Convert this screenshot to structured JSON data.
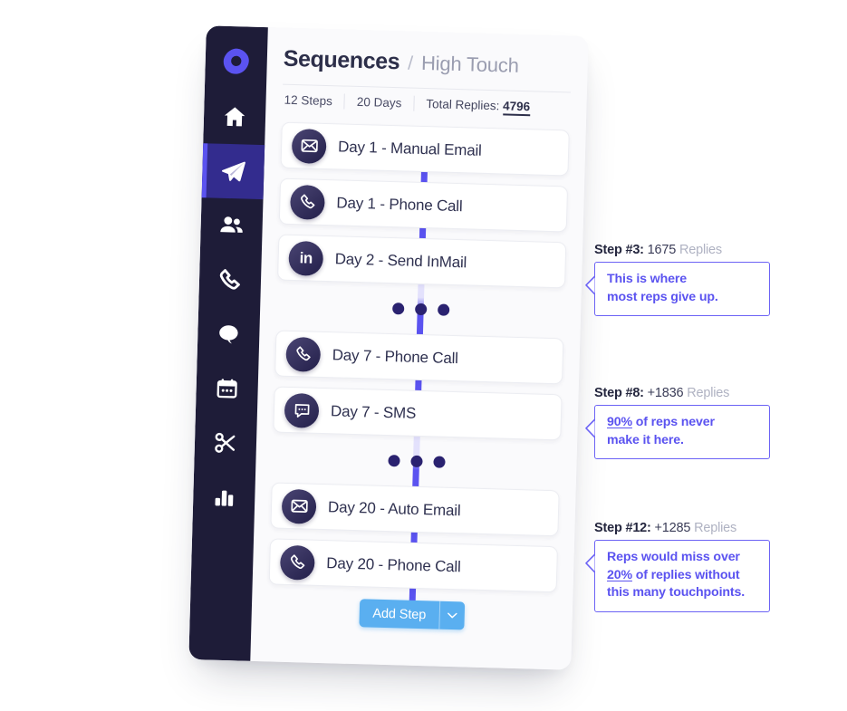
{
  "app": {
    "logo_icon": "droplet-logo-icon",
    "sidebar": {
      "items": [
        {
          "icon": "home-icon",
          "name": "home",
          "active": false
        },
        {
          "icon": "paper-plane-icon",
          "name": "sequences",
          "active": true
        },
        {
          "icon": "people-icon",
          "name": "contacts",
          "active": false
        },
        {
          "icon": "phone-icon",
          "name": "calls",
          "active": false
        },
        {
          "icon": "chat-bubble-icon",
          "name": "messages",
          "active": false
        },
        {
          "icon": "calendar-icon",
          "name": "calendar",
          "active": false
        },
        {
          "icon": "scissors-icon",
          "name": "snippets",
          "active": false
        },
        {
          "icon": "bar-chart-icon",
          "name": "analytics",
          "active": false
        }
      ]
    }
  },
  "header": {
    "title": "Sequences",
    "separator": "/",
    "subtitle": "High Touch",
    "meta": {
      "steps": "12 Steps",
      "days": "20 Days",
      "replies_label": "Total Replies:",
      "replies_value": "4796"
    }
  },
  "steps": [
    {
      "icon": "envelope-icon",
      "label": "Day 1 - Manual Email"
    },
    {
      "icon": "phone-icon",
      "label": "Day 1 - Phone Call"
    },
    {
      "icon": "linkedin-icon",
      "label": "Day 2 - Send InMail",
      "icon_text": "in"
    },
    {
      "icon": "ellipsis-icon",
      "label": "",
      "type": "ellipsis"
    },
    {
      "icon": "phone-icon",
      "label": "Day 7 - Phone Call"
    },
    {
      "icon": "sms-bubble-icon",
      "label": "Day 7 - SMS"
    },
    {
      "icon": "ellipsis-icon",
      "label": "",
      "type": "ellipsis"
    },
    {
      "icon": "envelope-icon",
      "label": "Day 20 - Auto Email"
    },
    {
      "icon": "phone-icon",
      "label": "Day 20 - Phone Call"
    }
  ],
  "add_step": {
    "label": "Add Step",
    "caret_icon": "chevron-down-icon"
  },
  "annotations": [
    {
      "step": "Step #3:",
      "count": "1675",
      "replies": "Replies",
      "lines": [
        {
          "text": "This is where"
        },
        {
          "text": "most reps give up."
        }
      ]
    },
    {
      "step": "Step #8:",
      "count": "+1836",
      "replies": "Replies",
      "lines": [
        {
          "underline": "90%",
          "text": " of reps never"
        },
        {
          "text": "make it here."
        }
      ]
    },
    {
      "step": "Step #12:",
      "count": "+1285",
      "replies": "Replies",
      "lines": [
        {
          "text": "Reps would miss over"
        },
        {
          "underline": "20%",
          "text": " of replies without"
        },
        {
          "text": "this many touchpoints."
        }
      ]
    }
  ],
  "colors": {
    "sidebar_bg": "#1E1C38",
    "sidebar_active_bg": "#332C8E",
    "accent_purple": "#5B53F0",
    "connector_purple": "#5B53F0",
    "dot_navy": "#2A2270",
    "add_step_blue": "#5AAFF0",
    "panel_bg": "#FAFAFC",
    "card_bg": "#FFFFFF",
    "title_navy": "#2D2F4A",
    "subtitle_gray": "#9A9DB0",
    "annotation_purple": "#5B53F0",
    "annotation_border": "#6C63F5"
  }
}
